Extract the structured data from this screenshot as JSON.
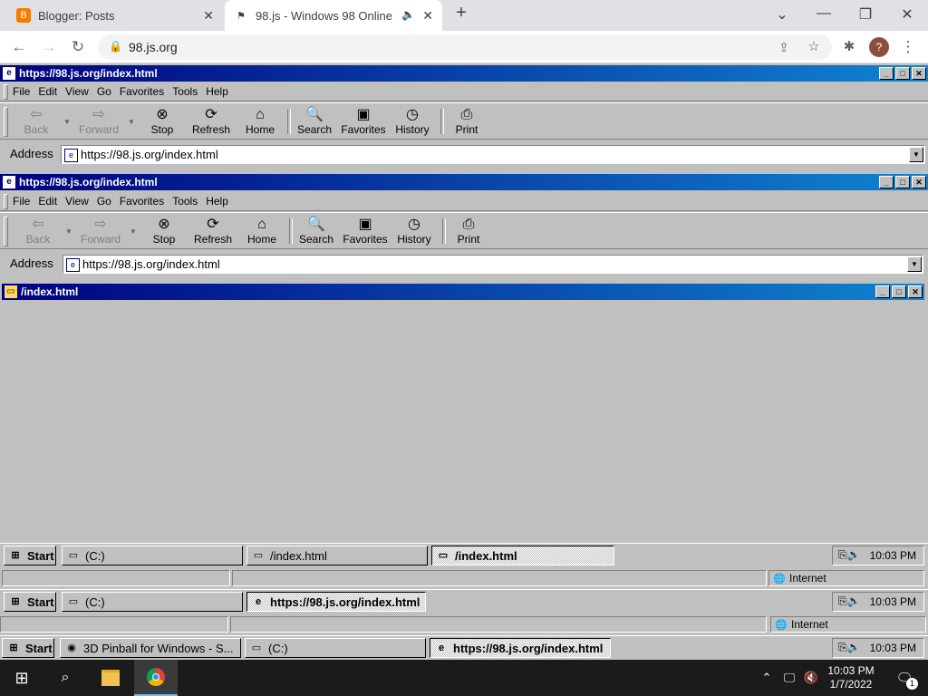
{
  "chrome": {
    "tabs": [
      {
        "title": "Blogger: Posts",
        "icon": "blogger-icon"
      },
      {
        "title": "98.js - Windows 98 Online",
        "icon": "windows98-icon"
      }
    ],
    "new_tab_label": "+",
    "url": "98.js.org",
    "profile_letter": "?"
  },
  "ie_outer": {
    "title": "https://98.js.org/index.html",
    "menu": [
      "File",
      "Edit",
      "View",
      "Go",
      "Favorites",
      "Tools",
      "Help"
    ],
    "toolbar": [
      "Back",
      "Forward",
      "Stop",
      "Refresh",
      "Home",
      "Search",
      "Favorites",
      "History",
      "Print"
    ],
    "address_label": "Address",
    "address": "https://98.js.org/index.html",
    "status_zone": "Internet"
  },
  "ie_inner": {
    "title": "https://98.js.org/index.html",
    "menu": [
      "File",
      "Edit",
      "View",
      "Go",
      "Favorites",
      "Tools",
      "Help"
    ],
    "toolbar": [
      "Back",
      "Forward",
      "Stop",
      "Refresh",
      "Home",
      "Search",
      "Favorites",
      "History",
      "Print"
    ],
    "address_label": "Address",
    "address": "https://98.js.org/index.html",
    "status_zone": "Internet"
  },
  "explorer": {
    "title": "/index.html"
  },
  "taskbar1": {
    "start": "Start",
    "buttons": [
      "(C:)",
      "/index.html",
      "/index.html"
    ],
    "clock": "10:03 PM"
  },
  "taskbar2": {
    "start": "Start",
    "buttons": [
      "(C:)",
      "https://98.js.org/index.html"
    ],
    "clock": "10:03 PM"
  },
  "taskbar3": {
    "start": "Start",
    "buttons": [
      "3D Pinball for Windows - S...",
      "(C:)",
      "https://98.js.org/index.html"
    ],
    "clock": "10:03 PM"
  },
  "win10": {
    "time": "10:03 PM",
    "date": "1/7/2022",
    "notifications": "1"
  }
}
